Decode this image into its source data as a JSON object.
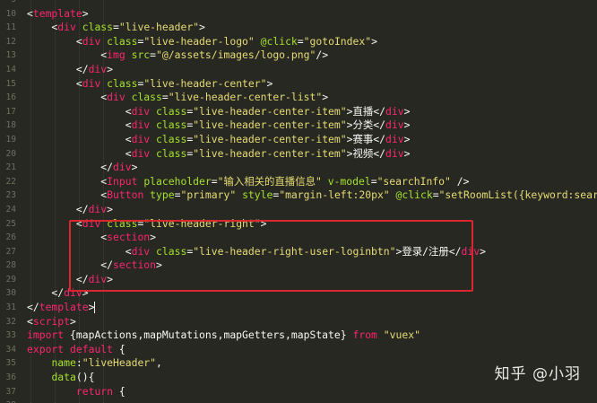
{
  "editor": {
    "line_numbers": [
      "9",
      "10",
      "11",
      "12",
      "13",
      "14",
      "15",
      "16",
      "17",
      "18",
      "19",
      "20",
      "21",
      "22",
      "23",
      "24",
      "25",
      "26",
      "27",
      "28",
      "29",
      "30",
      "31",
      "32",
      "33",
      "34",
      "35",
      "36",
      "37",
      "38"
    ],
    "lines": [
      [
        {
          "c": "p",
          "t": "    "
        }
      ],
      [
        {
          "c": "p",
          "t": "<"
        },
        {
          "c": "t",
          "t": "template"
        },
        {
          "c": "p",
          "t": ">"
        }
      ],
      [
        {
          "c": "p",
          "t": "    <"
        },
        {
          "c": "t",
          "t": "div"
        },
        {
          "c": "p",
          "t": " "
        },
        {
          "c": "a",
          "t": "class"
        },
        {
          "c": "p",
          "t": "="
        },
        {
          "c": "s",
          "t": "\"live-header\""
        },
        {
          "c": "p",
          "t": ">"
        }
      ],
      [
        {
          "c": "p",
          "t": "        <"
        },
        {
          "c": "t",
          "t": "div"
        },
        {
          "c": "p",
          "t": " "
        },
        {
          "c": "a",
          "t": "class"
        },
        {
          "c": "p",
          "t": "="
        },
        {
          "c": "s",
          "t": "\"live-header-logo\""
        },
        {
          "c": "p",
          "t": " "
        },
        {
          "c": "a",
          "t": "@click"
        },
        {
          "c": "p",
          "t": "="
        },
        {
          "c": "s",
          "t": "\"gotoIndex\""
        },
        {
          "c": "p",
          "t": ">"
        }
      ],
      [
        {
          "c": "p",
          "t": "            <"
        },
        {
          "c": "t",
          "t": "img"
        },
        {
          "c": "p",
          "t": " "
        },
        {
          "c": "a",
          "t": "src"
        },
        {
          "c": "p",
          "t": "="
        },
        {
          "c": "s",
          "t": "\"@/assets/images/logo.png\""
        },
        {
          "c": "p",
          "t": "/>"
        }
      ],
      [
        {
          "c": "p",
          "t": "        </"
        },
        {
          "c": "t",
          "t": "div"
        },
        {
          "c": "p",
          "t": ">"
        }
      ],
      [
        {
          "c": "p",
          "t": "        <"
        },
        {
          "c": "t",
          "t": "div"
        },
        {
          "c": "p",
          "t": " "
        },
        {
          "c": "a",
          "t": "class"
        },
        {
          "c": "p",
          "t": "="
        },
        {
          "c": "s",
          "t": "\"live-header-center\""
        },
        {
          "c": "p",
          "t": ">"
        }
      ],
      [
        {
          "c": "p",
          "t": "            <"
        },
        {
          "c": "t",
          "t": "div"
        },
        {
          "c": "p",
          "t": " "
        },
        {
          "c": "a",
          "t": "class"
        },
        {
          "c": "p",
          "t": "="
        },
        {
          "c": "s",
          "t": "\"live-header-center-list\""
        },
        {
          "c": "p",
          "t": ">"
        }
      ],
      [
        {
          "c": "p",
          "t": "                <"
        },
        {
          "c": "t",
          "t": "div"
        },
        {
          "c": "p",
          "t": " "
        },
        {
          "c": "a",
          "t": "class"
        },
        {
          "c": "p",
          "t": "="
        },
        {
          "c": "s",
          "t": "\"live-header-center-item\""
        },
        {
          "c": "p",
          "t": ">"
        },
        {
          "c": "cjk",
          "t": "直播"
        },
        {
          "c": "p",
          "t": "</"
        },
        {
          "c": "t",
          "t": "div"
        },
        {
          "c": "p",
          "t": ">"
        }
      ],
      [
        {
          "c": "p",
          "t": "                <"
        },
        {
          "c": "t",
          "t": "div"
        },
        {
          "c": "p",
          "t": " "
        },
        {
          "c": "a",
          "t": "class"
        },
        {
          "c": "p",
          "t": "="
        },
        {
          "c": "s",
          "t": "\"live-header-center-item\""
        },
        {
          "c": "p",
          "t": ">"
        },
        {
          "c": "cjk",
          "t": "分类"
        },
        {
          "c": "p",
          "t": "</"
        },
        {
          "c": "t",
          "t": "div"
        },
        {
          "c": "p",
          "t": ">"
        }
      ],
      [
        {
          "c": "p",
          "t": "                <"
        },
        {
          "c": "t",
          "t": "div"
        },
        {
          "c": "p",
          "t": " "
        },
        {
          "c": "a",
          "t": "class"
        },
        {
          "c": "p",
          "t": "="
        },
        {
          "c": "s",
          "t": "\"live-header-center-item\""
        },
        {
          "c": "p",
          "t": ">"
        },
        {
          "c": "cjk",
          "t": "赛事"
        },
        {
          "c": "p",
          "t": "</"
        },
        {
          "c": "t",
          "t": "div"
        },
        {
          "c": "p",
          "t": ">"
        }
      ],
      [
        {
          "c": "p",
          "t": "                <"
        },
        {
          "c": "t",
          "t": "div"
        },
        {
          "c": "p",
          "t": " "
        },
        {
          "c": "a",
          "t": "class"
        },
        {
          "c": "p",
          "t": "="
        },
        {
          "c": "s",
          "t": "\"live-header-center-item\""
        },
        {
          "c": "p",
          "t": ">"
        },
        {
          "c": "cjk",
          "t": "视频"
        },
        {
          "c": "p",
          "t": "</"
        },
        {
          "c": "t",
          "t": "div"
        },
        {
          "c": "p",
          "t": ">"
        }
      ],
      [
        {
          "c": "p",
          "t": "            </"
        },
        {
          "c": "t",
          "t": "div"
        },
        {
          "c": "p",
          "t": ">"
        }
      ],
      [
        {
          "c": "p",
          "t": "            <"
        },
        {
          "c": "t",
          "t": "Input"
        },
        {
          "c": "p",
          "t": " "
        },
        {
          "c": "a",
          "t": "placeholder"
        },
        {
          "c": "p",
          "t": "="
        },
        {
          "c": "s",
          "t": "\"输入相关的直播信息\""
        },
        {
          "c": "p",
          "t": " "
        },
        {
          "c": "a",
          "t": "v-model"
        },
        {
          "c": "p",
          "t": "="
        },
        {
          "c": "s",
          "t": "\"searchInfo\""
        },
        {
          "c": "p",
          "t": " />"
        }
      ],
      [
        {
          "c": "p",
          "t": "            <"
        },
        {
          "c": "t",
          "t": "Button"
        },
        {
          "c": "p",
          "t": " "
        },
        {
          "c": "a",
          "t": "type"
        },
        {
          "c": "p",
          "t": "="
        },
        {
          "c": "s",
          "t": "\"primary\""
        },
        {
          "c": "p",
          "t": " "
        },
        {
          "c": "a",
          "t": "style"
        },
        {
          "c": "p",
          "t": "="
        },
        {
          "c": "s",
          "t": "\"margin-left:20px\""
        },
        {
          "c": "p",
          "t": " "
        },
        {
          "c": "a",
          "t": "@click"
        },
        {
          "c": "p",
          "t": "="
        },
        {
          "c": "s",
          "t": "\"setRoomList({keyword:searchInfo"
        }
      ],
      [
        {
          "c": "p",
          "t": "        </"
        },
        {
          "c": "t",
          "t": "div"
        },
        {
          "c": "p",
          "t": ">"
        }
      ],
      [
        {
          "c": "p",
          "t": "        <"
        },
        {
          "c": "t",
          "t": "div"
        },
        {
          "c": "p",
          "t": " "
        },
        {
          "c": "a",
          "t": "class"
        },
        {
          "c": "p",
          "t": "="
        },
        {
          "c": "s",
          "t": "\"live-header-right\""
        },
        {
          "c": "p",
          "t": ">"
        }
      ],
      [
        {
          "c": "p",
          "t": "            <"
        },
        {
          "c": "t",
          "t": "section"
        },
        {
          "c": "p",
          "t": ">"
        }
      ],
      [
        {
          "c": "p",
          "t": "                <"
        },
        {
          "c": "t",
          "t": "div"
        },
        {
          "c": "p",
          "t": " "
        },
        {
          "c": "a",
          "t": "class"
        },
        {
          "c": "p",
          "t": "="
        },
        {
          "c": "s",
          "t": "\"live-header-right-user-loginbtn\""
        },
        {
          "c": "p",
          "t": ">"
        },
        {
          "c": "cjk",
          "t": "登录/注册"
        },
        {
          "c": "p",
          "t": "</"
        },
        {
          "c": "t",
          "t": "div"
        },
        {
          "c": "p",
          "t": ">"
        }
      ],
      [
        {
          "c": "p",
          "t": "            </"
        },
        {
          "c": "t",
          "t": "section"
        },
        {
          "c": "p",
          "t": ">"
        }
      ],
      [
        {
          "c": "p",
          "t": "        </"
        },
        {
          "c": "t",
          "t": "div"
        },
        {
          "c": "p",
          "t": ">"
        }
      ],
      [
        {
          "c": "p",
          "t": "    </"
        },
        {
          "c": "t",
          "t": "div"
        },
        {
          "c": "p",
          "t": ">"
        }
      ],
      [
        {
          "c": "p",
          "t": "</"
        },
        {
          "c": "t",
          "t": "template"
        },
        {
          "c": "p",
          "t": ">"
        }
      ],
      [
        {
          "c": "p",
          "t": "<"
        },
        {
          "c": "t",
          "t": "script"
        },
        {
          "c": "p",
          "t": ">"
        }
      ],
      [
        {
          "c": "k",
          "t": "import"
        },
        {
          "c": "p",
          "t": " {mapActions,mapMutations,mapGetters,mapState} "
        },
        {
          "c": "k",
          "t": "from"
        },
        {
          "c": "p",
          "t": " "
        },
        {
          "c": "s",
          "t": "\"vuex\""
        }
      ],
      [
        {
          "c": "k",
          "t": "export"
        },
        {
          "c": "p",
          "t": " "
        },
        {
          "c": "k",
          "t": "default"
        },
        {
          "c": "p",
          "t": " {"
        }
      ],
      [
        {
          "c": "p",
          "t": "    "
        },
        {
          "c": "f",
          "t": "name"
        },
        {
          "c": "p",
          "t": ":"
        },
        {
          "c": "s",
          "t": "\"liveHeader\""
        },
        {
          "c": "p",
          "t": ","
        }
      ],
      [
        {
          "c": "p",
          "t": "    "
        },
        {
          "c": "f",
          "t": "data"
        },
        {
          "c": "p",
          "t": "(){"
        }
      ],
      [
        {
          "c": "p",
          "t": "        "
        },
        {
          "c": "k",
          "t": "return"
        },
        {
          "c": "p",
          "t": " {"
        }
      ],
      [
        {
          "c": "p",
          "t": "            "
        }
      ]
    ],
    "cursor_line": 22
  },
  "watermark": {
    "text": "知乎 @小羽"
  }
}
